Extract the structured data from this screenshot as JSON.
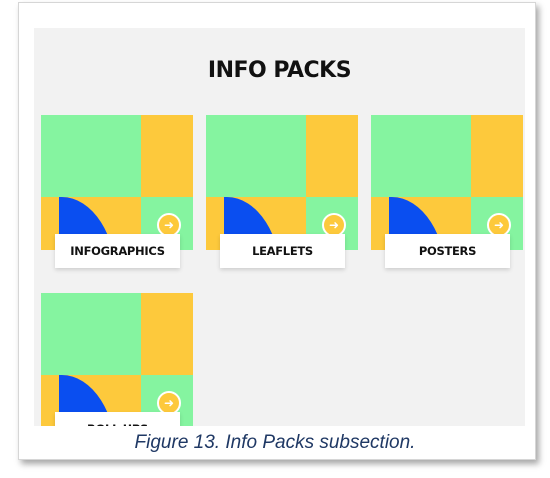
{
  "section": {
    "title": "INFO PACKS"
  },
  "cards": [
    {
      "label": "INFOGRAPHICS",
      "arrow": "➜",
      "icon": "arrow-right-icon"
    },
    {
      "label": "LEAFLETS",
      "arrow": "➜",
      "icon": "arrow-right-icon"
    },
    {
      "label": "POSTERS",
      "arrow": "➜",
      "icon": "arrow-right-icon"
    },
    {
      "label": "ROLL UPS",
      "arrow": "➜",
      "icon": "arrow-right-icon"
    }
  ],
  "caption": "Figure 13. Info Packs subsection.",
  "colors": {
    "green": "#85f4a0",
    "yellow": "#fdc93c",
    "blue": "#0a4ef0",
    "panel": "#f2f2f2"
  }
}
